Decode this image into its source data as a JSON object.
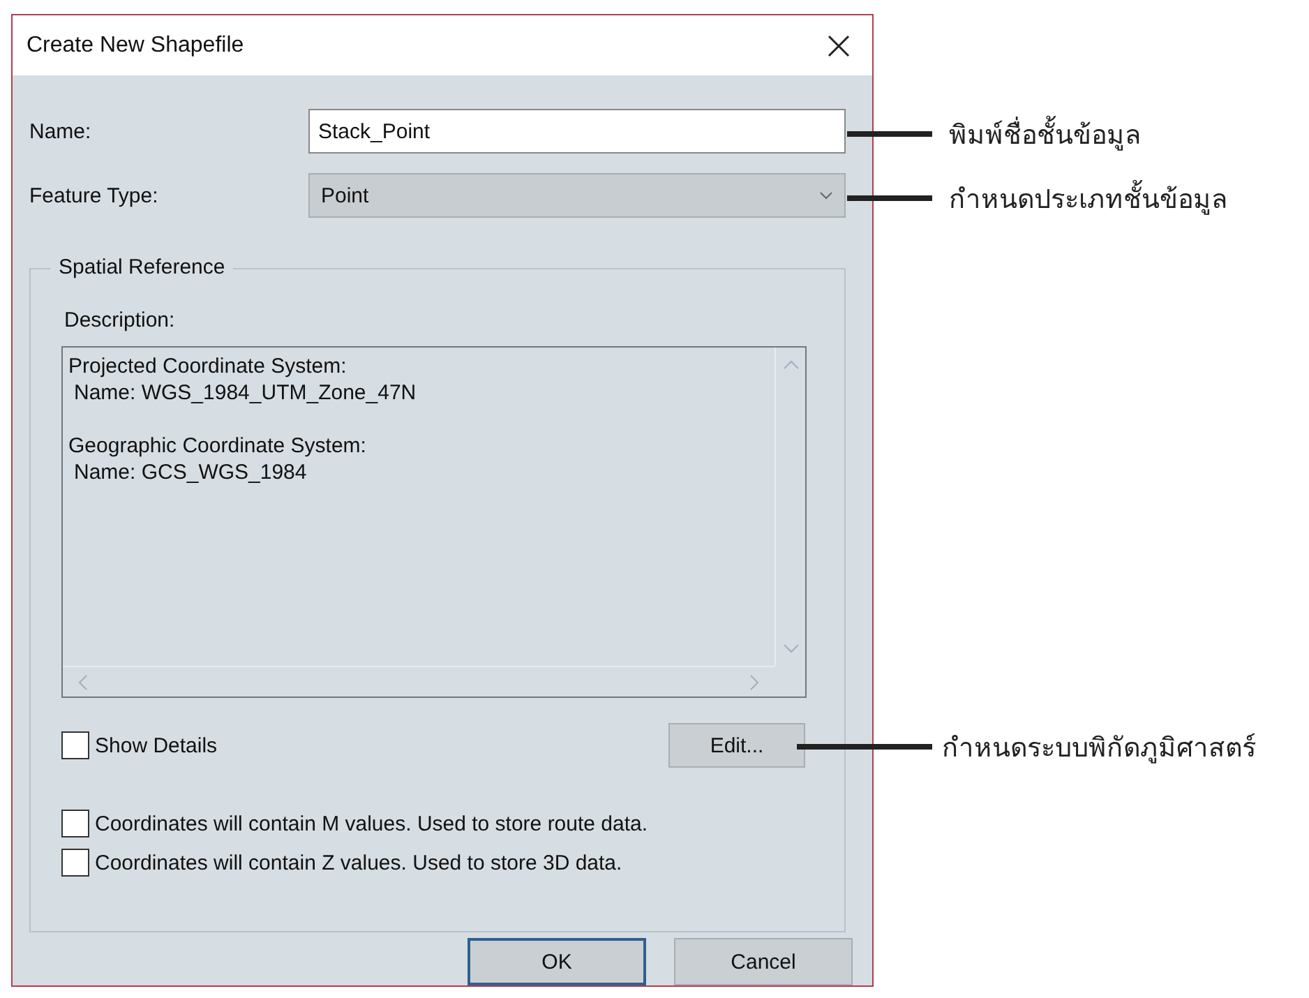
{
  "window": {
    "title": "Create New Shapefile"
  },
  "name_field": {
    "label": "Name:",
    "value": "Stack_Point"
  },
  "feature_type": {
    "label": "Feature Type:",
    "value": "Point"
  },
  "spatial_reference": {
    "title": "Spatial Reference",
    "description_label": "Description:",
    "description": [
      {
        "heading": "Projected Coordinate System:",
        "name": "Name: WGS_1984_UTM_Zone_47N"
      },
      {
        "heading": "Geographic Coordinate System:",
        "name": "Name: GCS_WGS_1984"
      }
    ],
    "show_details": {
      "label": "Show Details",
      "checked": false
    },
    "edit_button": "Edit..."
  },
  "options": [
    {
      "label": "Coordinates will contain M values. Used to store route data.",
      "checked": false
    },
    {
      "label": "Coordinates will contain Z values. Used to store 3D data.",
      "checked": false
    }
  ],
  "buttons": [
    {
      "label": "OK",
      "default": true
    },
    {
      "label": "Cancel",
      "default": false
    }
  ],
  "annotations": [
    {
      "text": "พิมพ์ชื่อชั้นข้อมูล"
    },
    {
      "text": "กำหนดประเภทชั้นข้อมูล"
    },
    {
      "text": "กำหนดระบบพิกัดภูมิศาสตร์"
    }
  ]
}
